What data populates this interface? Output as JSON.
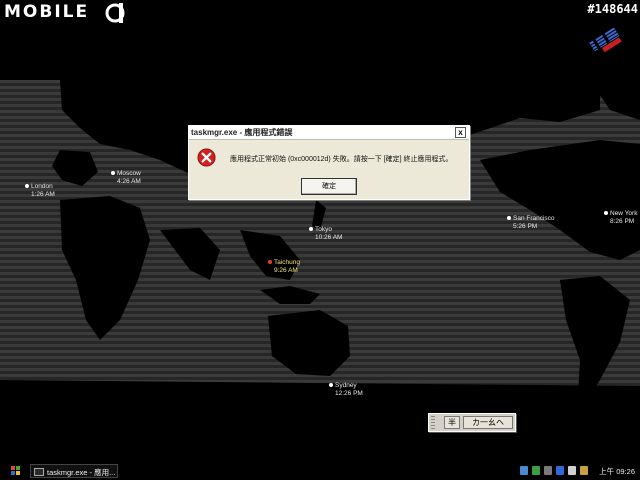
{
  "brand": {
    "text": "MOBILE"
  },
  "watermark": "#148644",
  "dialog": {
    "title": "taskmgr.exe - 應用程式錯誤",
    "close_label": "x",
    "message": "應用程式正常初始 (0xc000012d) 失敗。請按一下 [確定] 終止應用程式。",
    "ok_label": "確定"
  },
  "cities": [
    {
      "name": "Moscow",
      "time": "4:26 AM"
    },
    {
      "name": "London",
      "time": "1:26 AM"
    },
    {
      "name": "Tokyo",
      "time": "10:26 AM"
    },
    {
      "name": "Taichung",
      "time": "9:26 AM"
    },
    {
      "name": "San Francisco",
      "time": "5:26 PM"
    },
    {
      "name": "New York",
      "time": "8:26 PM"
    },
    {
      "name": "Sydney",
      "time": "12:26 PM"
    }
  ],
  "ime": {
    "mode": "半",
    "input": "カ一幺ヘ"
  },
  "taskbar": {
    "task_label": "taskmgr.exe - 應用...",
    "clock": "上午 09:26"
  },
  "colors": {
    "dialog_bg": "#ece9d8",
    "home_city": "#f2e27a",
    "error_red": "#d42020"
  },
  "icons": [
    "start-icon",
    "error-icon",
    "close-icon",
    "ibm-logo",
    "mobile01-logo"
  ]
}
